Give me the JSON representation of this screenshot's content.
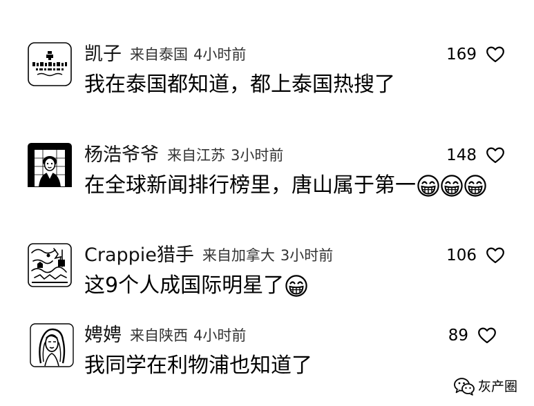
{
  "comments": [
    {
      "username": "凯子",
      "location": "来自泰国",
      "time": "4小时前",
      "likes": 169,
      "text": "我在泰国都知道，都上泰国热搜了",
      "emojis": []
    },
    {
      "username": "杨浩爷爷",
      "location": "来自江苏",
      "time": "3小时前",
      "likes": 148,
      "text": "在全球新闻排行榜里，唐山属于第一",
      "emojis": [
        "grinning-face",
        "grinning-face",
        "grinning-face"
      ]
    },
    {
      "username": "Crappie猎手",
      "location": "来自加拿大",
      "time": "3小时前",
      "likes": 106,
      "text": "这9个人成国际明星了",
      "emojis": [
        "grinning-face"
      ]
    },
    {
      "username": "娉娉",
      "location": "来自陕西",
      "time": "4小时前",
      "likes": 89,
      "text": "我同学在利物浦也知道了",
      "emojis": []
    }
  ],
  "icons": {
    "like": "heart-outline-icon",
    "watermark": "wechat-icon"
  },
  "watermark": {
    "text": "灰产圈"
  },
  "colors": {
    "background": "#ffffff",
    "text": "#000000",
    "meta": "#333333"
  }
}
